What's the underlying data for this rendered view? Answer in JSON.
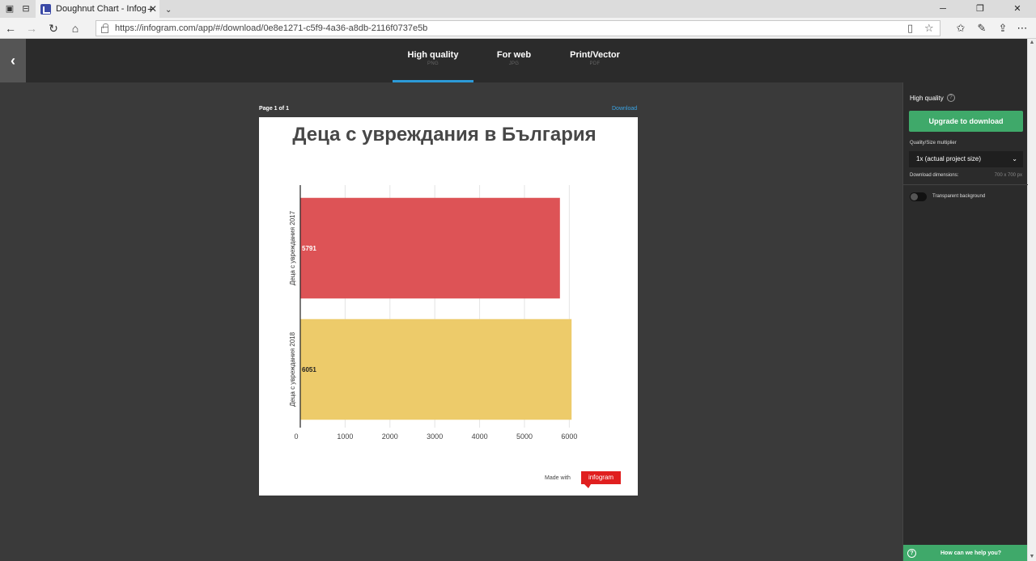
{
  "browser": {
    "tab_title": "Doughnut Chart - Infog",
    "url": "https://infogram.com/app/#/download/0e8e1271-c5f9-4a36-a8db-2116f0737e5b"
  },
  "header": {
    "tabs": [
      {
        "label": "High quality",
        "sub": "PNG"
      },
      {
        "label": "For web",
        "sub": "JPG"
      },
      {
        "label": "Print/Vector",
        "sub": "PDF"
      }
    ]
  },
  "preview": {
    "page_label": "Page 1 of 1",
    "download_link": "Download",
    "made_with": "Made with",
    "brand": "infogram"
  },
  "side_panel": {
    "title": "High quality",
    "upgrade_button": "Upgrade to download",
    "quality_label": "Quality/Size multiplier",
    "quality_value": "1x (actual project size)",
    "dimensions_label": "Download dimensions:",
    "dimensions_value": "700 x 700 px",
    "transparent_label": "Transparent background",
    "help_bar": "How can we help you?"
  },
  "chart_data": {
    "type": "bar",
    "orientation": "horizontal",
    "title": "Деца с увреждания в България",
    "categories": [
      "Деца с увреждания 2017",
      "Деца с увреждания 2018"
    ],
    "values": [
      5791,
      6051
    ],
    "colors": [
      "#dd5356",
      "#edcb6a"
    ],
    "x_ticks": [
      0,
      1000,
      2000,
      3000,
      4000,
      5000,
      6000
    ],
    "xlim": [
      0,
      6300
    ],
    "grid": true
  }
}
